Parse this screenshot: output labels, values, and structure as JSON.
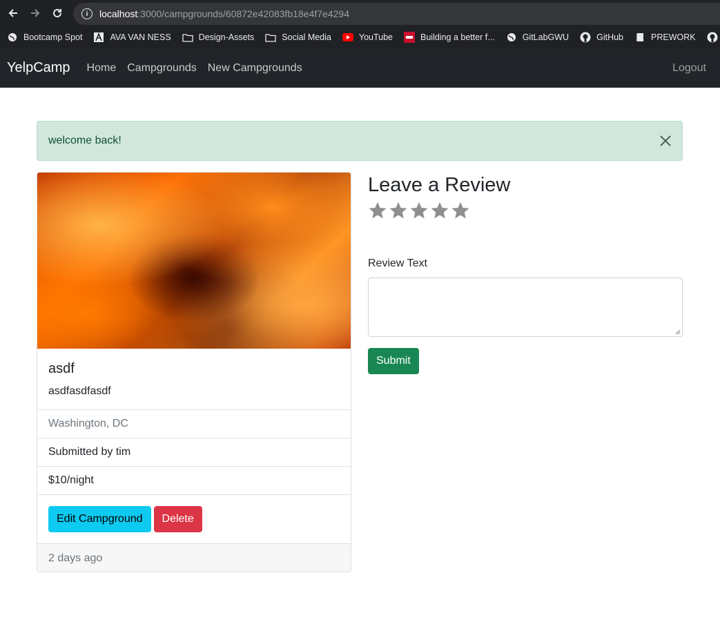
{
  "browser": {
    "url_host": "localhost",
    "url_path": ":3000/campgrounds/60872e42083fb18e4f7e4294",
    "bookmarks": [
      {
        "label": "Bootcamp Spot",
        "icon": "globe-icon"
      },
      {
        "label": "AVA VAN NESS",
        "icon": "ava-logo-icon"
      },
      {
        "label": "Design-Assets",
        "icon": "folder-icon"
      },
      {
        "label": "Social Media",
        "icon": "folder-icon"
      },
      {
        "label": "YouTube",
        "icon": "youtube-icon"
      },
      {
        "label": "Building a better f...",
        "icon": "site-icon"
      },
      {
        "label": "GitLabGWU",
        "icon": "globe-icon"
      },
      {
        "label": "GitHub",
        "icon": "github-icon"
      },
      {
        "label": "PREWORK",
        "icon": "book-icon"
      }
    ]
  },
  "navbar": {
    "brand": "YelpCamp",
    "links": [
      "Home",
      "Campgrounds",
      "New Campgrounds"
    ],
    "logout": "Logout"
  },
  "alert": {
    "message": "welcome back!",
    "color": "#d1e7dd"
  },
  "campground": {
    "title": "asdf",
    "description": "asdfasdfasdf",
    "location": "Washington, DC",
    "submitted_by": "Submitted by tim",
    "price": "$10/night",
    "edit_label": "Edit Campground",
    "delete_label": "Delete",
    "footer": "2 days ago"
  },
  "review": {
    "heading": "Leave a Review",
    "rating_stars": 5,
    "rating_value": 0,
    "text_label": "Review Text",
    "text_value": "",
    "submit_label": "Submit"
  },
  "colors": {
    "info": "#0dcaf0",
    "danger": "#dc3545",
    "success": "#198754",
    "navbar": "#212529"
  }
}
